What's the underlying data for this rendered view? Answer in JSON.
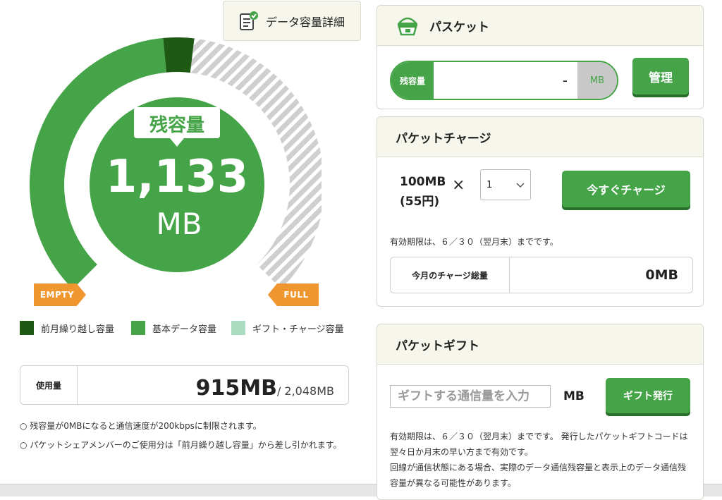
{
  "left": {
    "detail_button": "データ容量詳細",
    "gauge": {
      "remaining_label": "残容量",
      "remaining_value": "1,133",
      "remaining_unit": "MB",
      "empty_tag": "EMPTY",
      "full_tag": "FULL",
      "fractions": {
        "carryover": 0.045,
        "basic": 0.48,
        "gift_charge": 0.475
      }
    },
    "legend": [
      {
        "label": "前月繰り越し容量",
        "color": "#1f5a15"
      },
      {
        "label": "基本データ容量",
        "color": "#45a447"
      },
      {
        "label": "ギフト・チャージ容量",
        "color": "#a9dcc0"
      }
    ],
    "usage": {
      "label": "使用量",
      "used": "915MB",
      "total": " / 2,048MB"
    },
    "notes": [
      "残容量が0MBになると通信速度が200kbpsに制限されます。",
      "パケットシェアメンバーのご使用分は「前月繰り越し容量」から差し引かれます。"
    ]
  },
  "paketto": {
    "title": "パスケット",
    "remaining_label": "残容量",
    "value": "-",
    "unit": "MB",
    "manage_button": "管理"
  },
  "charge": {
    "title": "パケットチャージ",
    "unit_amount": "100MB",
    "unit_price": "(55円)",
    "times": "×",
    "qty": "1",
    "charge_button": "今すぐチャージ",
    "expiry_note": "有効期限は、６／３０（翌月末）までです。",
    "total_label": "今月のチャージ総量",
    "total_value": "0MB"
  },
  "gift": {
    "title": "パケットギフト",
    "input_placeholder": "ギフトする通信量を入力",
    "unit": "MB",
    "issue_button": "ギフト発行",
    "note1": "有効期限は、６／３０（翌月末）までです。 発行したパケットギフトコードは翌々日か月末の早い方まで有効です。",
    "note2": "回線が通信状態にある場合、実際のデータ通信残容量と表示上のデータ通信残容量が異なる可能性があります。"
  }
}
